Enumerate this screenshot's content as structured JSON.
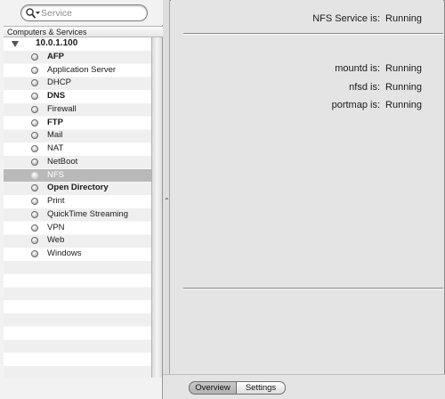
{
  "search": {
    "placeholder": "Service"
  },
  "list_header": "Computers & Services",
  "computer": {
    "name": "10.0.1.100"
  },
  "services": [
    {
      "name": "AFP",
      "bold": true,
      "selected": false
    },
    {
      "name": "Application Server",
      "bold": false,
      "selected": false
    },
    {
      "name": "DHCP",
      "bold": false,
      "selected": false
    },
    {
      "name": "DNS",
      "bold": true,
      "selected": false
    },
    {
      "name": "Firewall",
      "bold": false,
      "selected": false
    },
    {
      "name": "FTP",
      "bold": true,
      "selected": false
    },
    {
      "name": "Mail",
      "bold": false,
      "selected": false
    },
    {
      "name": "NAT",
      "bold": false,
      "selected": false
    },
    {
      "name": "NetBoot",
      "bold": false,
      "selected": false
    },
    {
      "name": "NFS",
      "bold": false,
      "selected": true
    },
    {
      "name": "Open Directory",
      "bold": true,
      "selected": false
    },
    {
      "name": "Print",
      "bold": false,
      "selected": false
    },
    {
      "name": "QuickTime Streaming",
      "bold": false,
      "selected": false
    },
    {
      "name": "VPN",
      "bold": false,
      "selected": false
    },
    {
      "name": "Web",
      "bold": false,
      "selected": false
    },
    {
      "name": "Windows",
      "bold": false,
      "selected": false
    }
  ],
  "overview": {
    "service_status": {
      "label": "NFS Service is:",
      "value": "Running"
    },
    "daemons": [
      {
        "label": "mountd is:",
        "value": "Running"
      },
      {
        "label": "nfsd is:",
        "value": "Running"
      },
      {
        "label": "portmap is:",
        "value": "Running"
      }
    ]
  },
  "tabs": [
    {
      "label": "Overview",
      "selected": true
    },
    {
      "label": "Settings",
      "selected": false
    }
  ],
  "icons": {
    "search": "magnifier-dropdown-icon",
    "disclosure": "disclosure-triangle-icon",
    "status": "status-dot-icon",
    "splitter": "splitter-handle-icon"
  }
}
